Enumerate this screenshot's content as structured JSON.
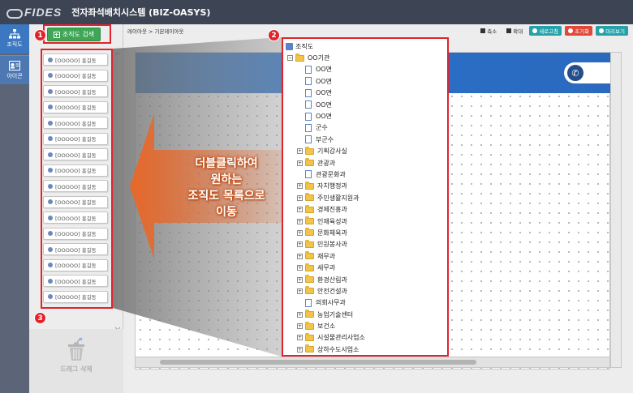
{
  "app": {
    "logo": "FIDES",
    "title": "전자좌석배치시스템 (BIZ-OASYS)"
  },
  "rail": {
    "items": [
      {
        "label": "조직도"
      },
      {
        "label": "아이콘"
      }
    ]
  },
  "left_panel": {
    "search_button": "조직도 검색",
    "employees": [
      "[OOOOO] 홍길동",
      "[OOOOO] 홍길동",
      "[OOOOO] 홍길동",
      "[OOOOO] 홍길동",
      "[OOOOO] 홍길동",
      "[OOOOO] 홍길동",
      "[OOOOO] 홍길동",
      "[OOOOO] 홍길동",
      "[OOOOO] 홍길동",
      "[OOOOO] 홍길동",
      "[OOOOO] 홍길동",
      "[OOOOO] 홍길동",
      "[OOOOO] 홍길동",
      "[OOOOO] 홍길동",
      "[OOOOO] 홍길동",
      "[OOOOO] 홍길동"
    ],
    "trash_label": "드래그 삭제"
  },
  "main": {
    "breadcrumb": "레이아웃 > 기본레이아웃",
    "toolbar": {
      "zoom_out": "축소",
      "zoom_in": "확대",
      "refresh": "새로고침",
      "reset": "초기화",
      "preview": "미리보기"
    }
  },
  "tree": {
    "root": "조직도",
    "org": "OO기관",
    "items": [
      {
        "label": "OO면",
        "type": "doc",
        "depth": 2
      },
      {
        "label": "OO면",
        "type": "doc",
        "depth": 2
      },
      {
        "label": "OO면",
        "type": "doc",
        "depth": 2
      },
      {
        "label": "OO면",
        "type": "doc",
        "depth": 2
      },
      {
        "label": "OO면",
        "type": "doc",
        "depth": 2
      },
      {
        "label": "군수",
        "type": "doc",
        "depth": 2
      },
      {
        "label": "부군수",
        "type": "doc",
        "depth": 2
      },
      {
        "label": "기획감사실",
        "type": "folder",
        "depth": 1
      },
      {
        "label": "관광과",
        "type": "folder",
        "depth": 1
      },
      {
        "label": "관광문화과",
        "type": "doc",
        "depth": 2
      },
      {
        "label": "자치행정과",
        "type": "folder",
        "depth": 1
      },
      {
        "label": "주민생활지원과",
        "type": "folder",
        "depth": 1
      },
      {
        "label": "경제진흥과",
        "type": "folder",
        "depth": 1
      },
      {
        "label": "인재육성과",
        "type": "folder",
        "depth": 1
      },
      {
        "label": "문화체육과",
        "type": "folder",
        "depth": 1
      },
      {
        "label": "민원봉사과",
        "type": "folder",
        "depth": 1
      },
      {
        "label": "재무과",
        "type": "folder",
        "depth": 1
      },
      {
        "label": "세무과",
        "type": "folder",
        "depth": 1
      },
      {
        "label": "환경산림과",
        "type": "folder",
        "depth": 1
      },
      {
        "label": "안전건설과",
        "type": "folder",
        "depth": 1
      },
      {
        "label": "의회사무과",
        "type": "doc",
        "depth": 2
      },
      {
        "label": "농업기술센터",
        "type": "folder",
        "depth": 1
      },
      {
        "label": "보건소",
        "type": "folder",
        "depth": 1
      },
      {
        "label": "시설물관리사업소",
        "type": "folder",
        "depth": 1
      },
      {
        "label": "상하수도사업소",
        "type": "folder",
        "depth": 1
      }
    ]
  },
  "callout": {
    "line1": "더블클릭하여",
    "line2": "원하는",
    "line3": "조직도 목록으로",
    "line4": "이동"
  },
  "badges": {
    "b1": "1",
    "b2": "2",
    "b3": "3"
  },
  "colors": {
    "accent_red": "#e0242b",
    "arrow_orange": "#e8682a",
    "topbar": "#3d4554",
    "canvas_blue": "#2a6cc0",
    "search_green": "#3ea655"
  }
}
